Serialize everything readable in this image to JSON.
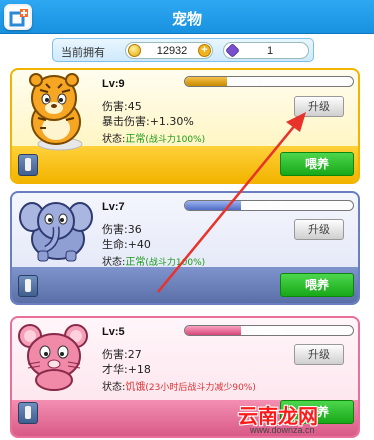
{
  "header": {
    "title": "宠物",
    "back_icon": "back-add-icon"
  },
  "resources": {
    "label": "当前拥有",
    "coins": "12932",
    "gems": "1",
    "plus": "+"
  },
  "pets": [
    {
      "level": "Lv:9",
      "xp_percent_text": "25%",
      "xp_fraction": 0.25,
      "stat1": "伤害:45",
      "stat2": "暴击伤害:+1.30%",
      "status_label": "状态:",
      "status_value": "正常",
      "status_sub": "(战斗力100%)",
      "upgrade": "升级",
      "feed": "喂养",
      "theme": "#f5b400",
      "avatar": "tiger-icon"
    },
    {
      "level": "Lv:7",
      "xp_percent_text": "33.33%",
      "xp_fraction": 0.3333,
      "stat1": "伤害:36",
      "stat2": "生命:+40",
      "status_label": "状态:",
      "status_value": "正常",
      "status_sub": "(战斗力100%)",
      "upgrade": "升级",
      "feed": "喂养",
      "theme": "#6a7fc0",
      "avatar": "elephant-icon"
    },
    {
      "level": "Lv:5",
      "xp_percent_text": "33.33%",
      "xp_fraction": 0.3333,
      "stat1": "伤害:27",
      "stat2": "才华:+18",
      "status_label": "状态:",
      "status_value": "饥饿",
      "status_sub": "(23小时后战斗力减少90%)",
      "upgrade": "升级",
      "feed": "喂养",
      "theme": "#e8709a",
      "avatar": "mouse-icon"
    }
  ],
  "watermark": {
    "text": "云南龙网",
    "url": "www.downza.cn"
  }
}
